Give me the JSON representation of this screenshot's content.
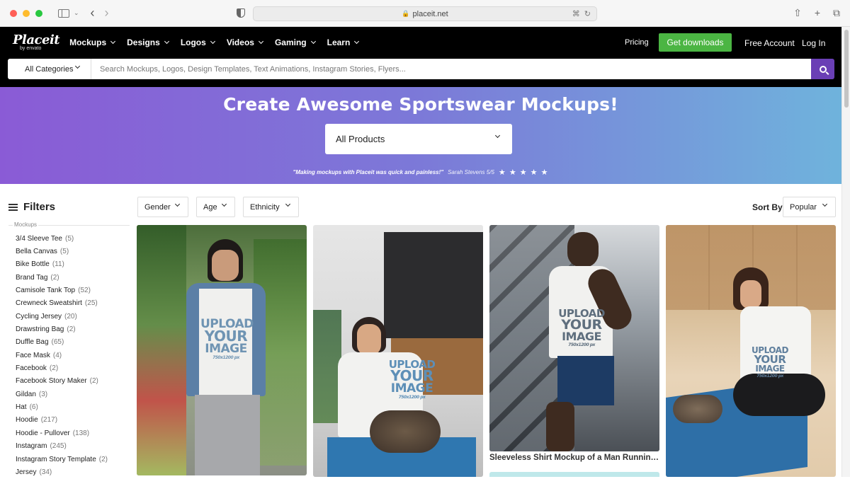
{
  "browser": {
    "url": "placeit.net",
    "traffic_colors": [
      "#ff5f57",
      "#febc2e",
      "#28c840"
    ]
  },
  "header": {
    "logo_word": "Placeit",
    "logo_sub": "by envato",
    "nav": [
      {
        "label": "Mockups"
      },
      {
        "label": "Designs"
      },
      {
        "label": "Logos"
      },
      {
        "label": "Videos"
      },
      {
        "label": "Gaming"
      },
      {
        "label": "Learn"
      }
    ],
    "pricing": "Pricing",
    "get_downloads": "Get downloads",
    "free_account": "Free Account",
    "log_in": "Log In"
  },
  "search": {
    "category": "All Categories",
    "placeholder": "Search Mockups, Logos, Design Templates, Text Animations, Instagram Stories, Flyers..."
  },
  "hero": {
    "title": "Create Awesome Sportswear Mockups!",
    "product_select": "All Products",
    "quote": "\"Making mockups with Placeit was quick and painless!\"",
    "author": "Sarah Stevens 5/5",
    "stars": "★ ★ ★ ★ ★",
    "rating": 5
  },
  "filters": {
    "title": "Filters",
    "category_label": "Mockups",
    "items": [
      {
        "label": "3/4 Sleeve Tee",
        "count": "(5)"
      },
      {
        "label": "Bella Canvas",
        "count": "(5)"
      },
      {
        "label": "Bike Bottle",
        "count": "(11)"
      },
      {
        "label": "Brand Tag",
        "count": "(2)"
      },
      {
        "label": "Camisole Tank Top",
        "count": "(52)"
      },
      {
        "label": "Crewneck Sweatshirt",
        "count": "(25)"
      },
      {
        "label": "Cycling Jersey",
        "count": "(20)"
      },
      {
        "label": "Drawstring Bag",
        "count": "(2)"
      },
      {
        "label": "Duffle Bag",
        "count": "(65)"
      },
      {
        "label": "Face Mask",
        "count": "(4)"
      },
      {
        "label": "Facebook",
        "count": "(2)"
      },
      {
        "label": "Facebook Story Maker",
        "count": "(2)"
      },
      {
        "label": "Gildan",
        "count": "(3)"
      },
      {
        "label": "Hat",
        "count": "(6)"
      },
      {
        "label": "Hoodie",
        "count": "(217)"
      },
      {
        "label": "Hoodie - Pullover",
        "count": "(138)"
      },
      {
        "label": "Instagram",
        "count": "(245)"
      },
      {
        "label": "Instagram Story Template",
        "count": "(2)"
      },
      {
        "label": "Jersey",
        "count": "(34)"
      }
    ],
    "dropdowns": {
      "gender": "Gender",
      "age": "Age",
      "ethnicity": "Ethnicity"
    },
    "sort_label": "Sort By",
    "sort_value": "Popular"
  },
  "cards": {
    "upload_line1": "UPLOAD",
    "upload_line2": "YOUR",
    "upload_line3": "IMAGE",
    "upload_size": "750x1200 px",
    "caption_3": "Sleeveless Shirt Mockup of a Man Running in ..."
  }
}
